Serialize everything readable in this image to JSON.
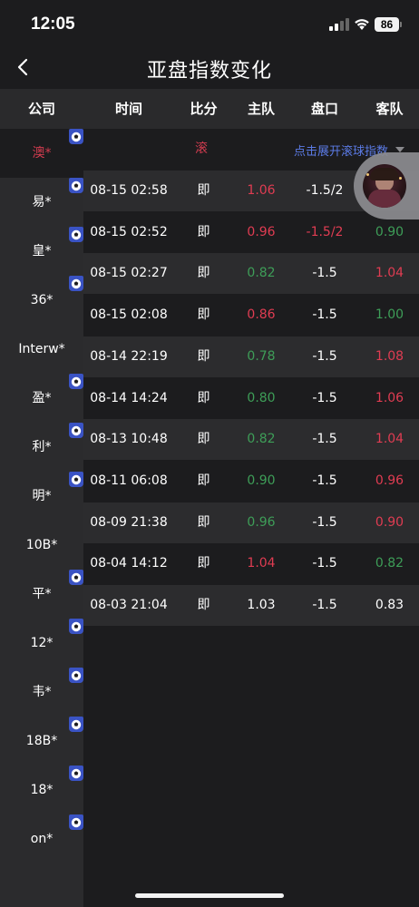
{
  "status_bar": {
    "time": "12:05",
    "battery": "86"
  },
  "nav": {
    "title": "亚盘指数变化"
  },
  "header": {
    "company": "公司",
    "time": "时间",
    "score": "比分",
    "home": "主队",
    "line": "盘口",
    "away": "客队"
  },
  "sidebar": {
    "items": [
      {
        "label": "澳*",
        "badge": true,
        "active": true
      },
      {
        "label": "易*",
        "badge": true,
        "active": false
      },
      {
        "label": "皇*",
        "badge": true,
        "active": false
      },
      {
        "label": "36*",
        "badge": true,
        "active": false
      },
      {
        "label": "Interw*",
        "badge": false,
        "active": false
      },
      {
        "label": "盈*",
        "badge": true,
        "active": false
      },
      {
        "label": "利*",
        "badge": true,
        "active": false
      },
      {
        "label": "明*",
        "badge": true,
        "active": false
      },
      {
        "label": "10B*",
        "badge": false,
        "active": false
      },
      {
        "label": "平*",
        "badge": true,
        "active": false
      },
      {
        "label": "12*",
        "badge": true,
        "active": false
      },
      {
        "label": "韦*",
        "badge": true,
        "active": false
      },
      {
        "label": "18B*",
        "badge": true,
        "active": false
      },
      {
        "label": "18*",
        "badge": true,
        "active": false
      },
      {
        "label": "on*",
        "badge": true,
        "active": false
      }
    ]
  },
  "rolling": {
    "label": "滚",
    "expand_link": "点击展开滚球指数"
  },
  "colors": {
    "red": "#e03c52",
    "green": "#3e9e58",
    "white": "#ffffff",
    "accent_blue": "#5b7be6",
    "badge_blue": "#3a53c4"
  },
  "table": {
    "rows": [
      {
        "time": "08-15 02:58",
        "score": "即",
        "home": "1.06",
        "home_color": "red",
        "line": "-1.5/2",
        "line_color": "white",
        "away": "",
        "away_color": "white"
      },
      {
        "time": "08-15 02:52",
        "score": "即",
        "home": "0.96",
        "home_color": "red",
        "line": "-1.5/2",
        "line_color": "red",
        "away": "0.90",
        "away_color": "green"
      },
      {
        "time": "08-15 02:27",
        "score": "即",
        "home": "0.82",
        "home_color": "green",
        "line": "-1.5",
        "line_color": "white",
        "away": "1.04",
        "away_color": "red"
      },
      {
        "time": "08-15 02:08",
        "score": "即",
        "home": "0.86",
        "home_color": "red",
        "line": "-1.5",
        "line_color": "white",
        "away": "1.00",
        "away_color": "green"
      },
      {
        "time": "08-14 22:19",
        "score": "即",
        "home": "0.78",
        "home_color": "green",
        "line": "-1.5",
        "line_color": "white",
        "away": "1.08",
        "away_color": "red"
      },
      {
        "time": "08-14 14:24",
        "score": "即",
        "home": "0.80",
        "home_color": "green",
        "line": "-1.5",
        "line_color": "white",
        "away": "1.06",
        "away_color": "red"
      },
      {
        "time": "08-13 10:48",
        "score": "即",
        "home": "0.82",
        "home_color": "green",
        "line": "-1.5",
        "line_color": "white",
        "away": "1.04",
        "away_color": "red"
      },
      {
        "time": "08-11 06:08",
        "score": "即",
        "home": "0.90",
        "home_color": "green",
        "line": "-1.5",
        "line_color": "white",
        "away": "0.96",
        "away_color": "red"
      },
      {
        "time": "08-09 21:38",
        "score": "即",
        "home": "0.96",
        "home_color": "green",
        "line": "-1.5",
        "line_color": "white",
        "away": "0.90",
        "away_color": "red"
      },
      {
        "time": "08-04 14:12",
        "score": "即",
        "home": "1.04",
        "home_color": "red",
        "line": "-1.5",
        "line_color": "white",
        "away": "0.82",
        "away_color": "green"
      },
      {
        "time": "08-03 21:04",
        "score": "即",
        "home": "1.03",
        "home_color": "white",
        "line": "-1.5",
        "line_color": "white",
        "away": "0.83",
        "away_color": "white"
      }
    ]
  }
}
